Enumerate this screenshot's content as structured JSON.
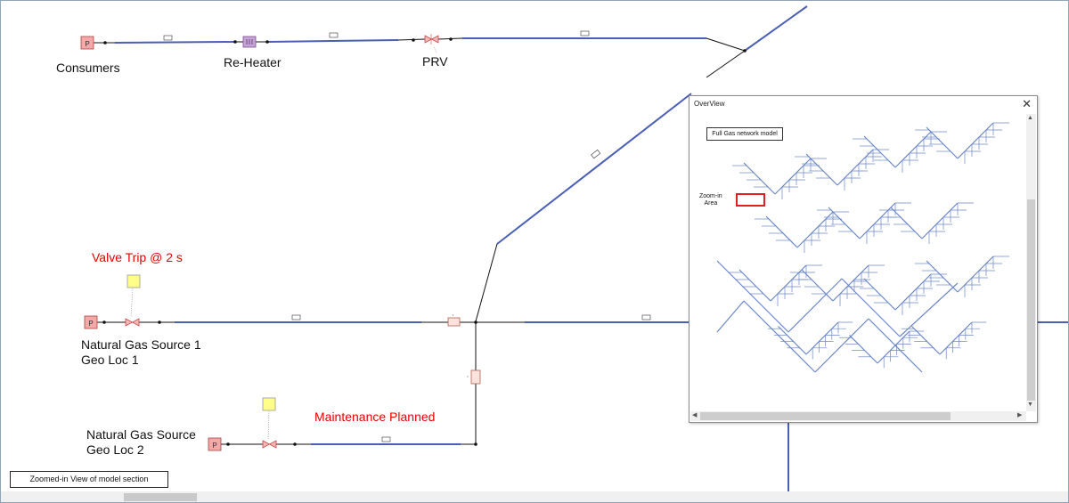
{
  "labels": {
    "consumers": "Consumers",
    "reheater": "Re-Heater",
    "prv": "PRV",
    "valve_trip": "Valve Trip @ 2 s",
    "source1_line1": "Natural Gas Source 1",
    "source1_line2": "Geo Loc 1",
    "source2_line1": "Natural Gas Source",
    "source2_line2": "Geo Loc 2",
    "maintenance": "Maintenance Planned"
  },
  "caption": "Zoomed-in View of model section",
  "symbol_letters": {
    "pressure_node": "P",
    "heater": "H"
  },
  "overview": {
    "title": "OverView",
    "close": "✕",
    "full_model_label": "Full Gas network model",
    "zoom_area_line1": "Zoom-in",
    "zoom_area_line2": "Area"
  },
  "colors": {
    "pipe": "#4a5fb5",
    "connector": "#111111",
    "pressure_node": "#f4a8a8",
    "heater": "#c7a4d6",
    "control_box": "#ffff88",
    "highlight": "#e02020",
    "overview_network": "#6b87c6"
  }
}
